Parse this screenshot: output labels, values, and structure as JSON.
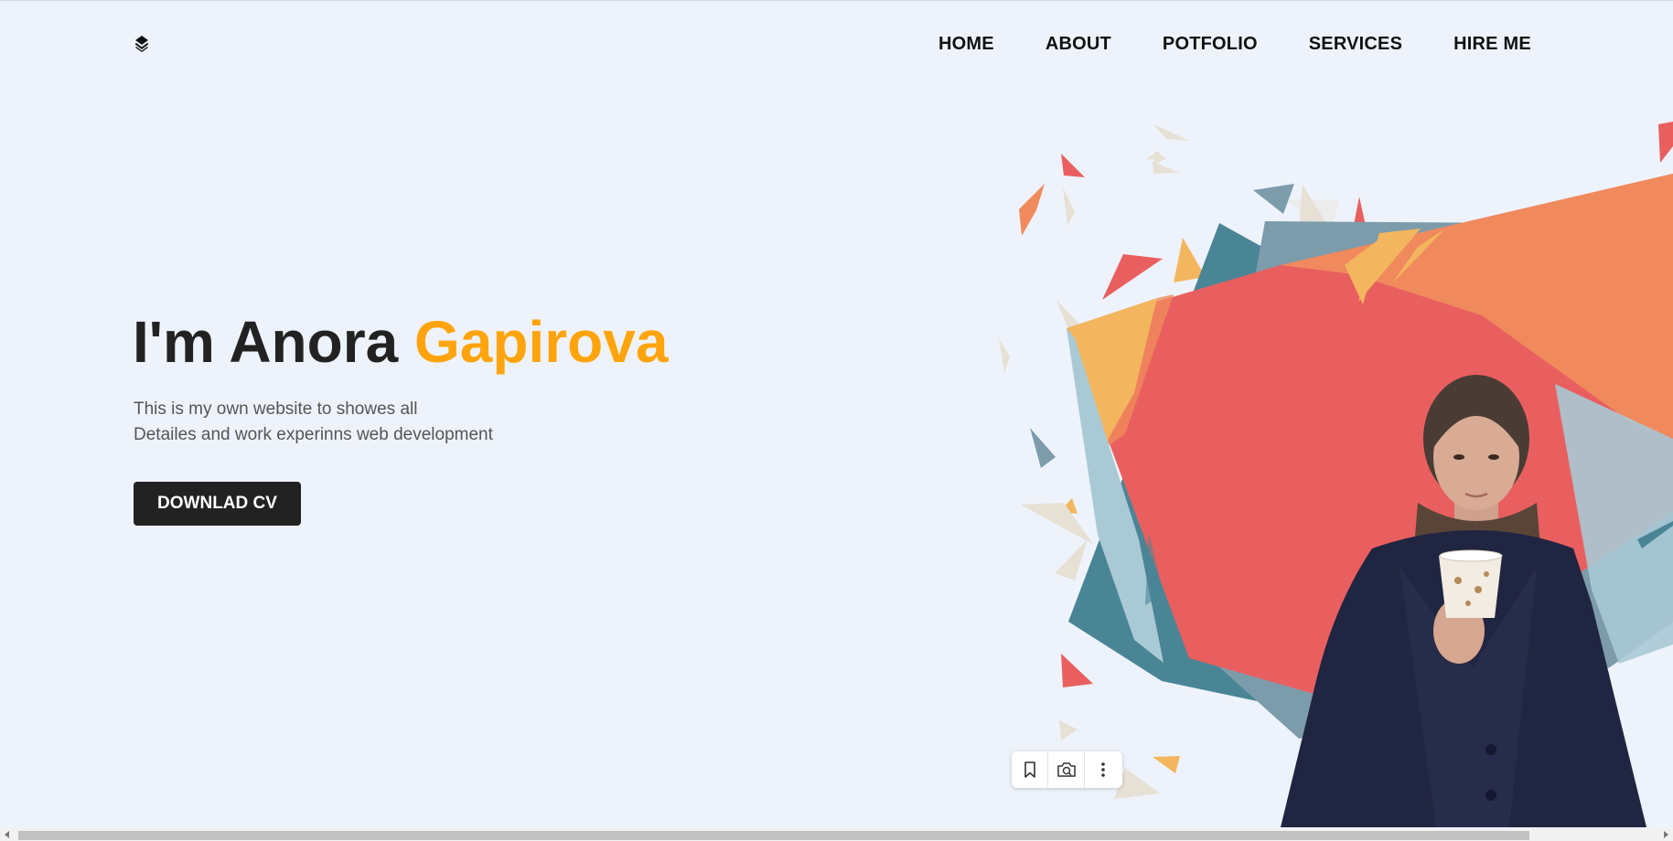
{
  "header": {
    "logo_icon": "layers-diamond-icon",
    "nav": [
      {
        "label": "HOME"
      },
      {
        "label": "ABOUT"
      },
      {
        "label": "POTFOLIO"
      },
      {
        "label": "SERVICES"
      },
      {
        "label": "HIRE ME"
      }
    ]
  },
  "hero": {
    "title_prefix": "I'm Anora ",
    "title_accent": "Gapirova",
    "subtitle_line1": "This is my own website to showes all",
    "subtitle_line2": "Detailes and work experinns web development",
    "cta_label": "DOWNLAD CV"
  },
  "colors": {
    "accent": "#ffa40c",
    "dark": "#222222",
    "background": "#eef3fb",
    "coral": "#e95f5f",
    "orange": "#f08a5d",
    "yellow": "#f3b65f",
    "teal": "#4a8596",
    "slate": "#7d9cab",
    "light_blue": "#a9c9d5",
    "cream": "#e6e0d5"
  },
  "float_toolbar": {
    "icons": [
      "bookmark-icon",
      "camera-search-icon",
      "more-vertical-icon"
    ]
  }
}
